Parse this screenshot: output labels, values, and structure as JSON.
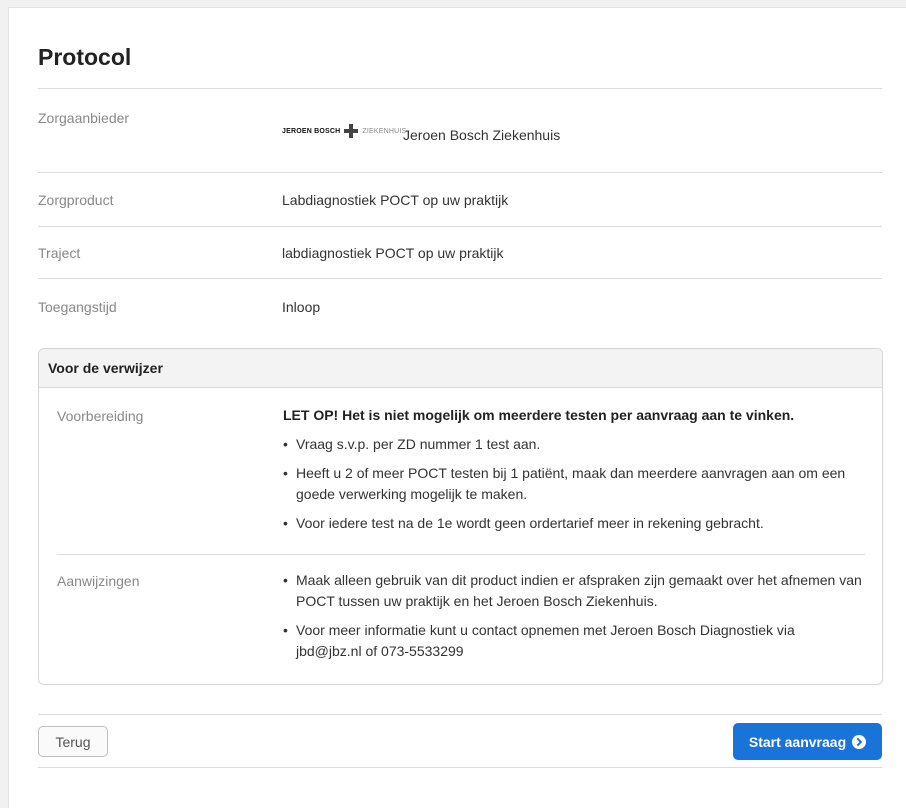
{
  "title": "Protocol",
  "fields": {
    "zorgaanbieder_label": "Zorgaanbieder",
    "logo_text_left": "JEROEN BOSCH",
    "logo_text_right": "ZIEKENHUIS",
    "zorgaanbieder_value": "Jeroen Bosch Ziekenhuis",
    "zorgproduct_label": "Zorgproduct",
    "zorgproduct_value": "Labdiagnostiek POCT op uw praktijk",
    "traject_label": "Traject",
    "traject_value": "labdiagnostiek POCT op uw praktijk",
    "toegangstijd_label": "Toegangstijd",
    "toegangstijd_value": "Inloop"
  },
  "card": {
    "header": "Voor de verwijzer",
    "voorbereiding_label": "Voorbereiding",
    "voorbereiding_heading": "LET OP! Het is niet mogelijk om meerdere testen per aanvraag aan te vinken.",
    "voorbereiding_items": [
      "Vraag s.v.p. per ZD nummer 1 test aan.",
      "Heeft u 2 of meer POCT testen bij 1 patiënt, maak dan meerdere aanvragen aan om een goede verwerking mogelijk te maken.",
      "Voor iedere test na de 1e wordt geen ordertarief meer in rekening gebracht."
    ],
    "aanwijzingen_label": "Aanwijzingen",
    "aanwijzingen_items": [
      "Maak alleen gebruik van dit product indien er afspraken zijn gemaakt over het afnemen van POCT tussen uw praktijk en het Jeroen Bosch Ziekenhuis.",
      "Voor meer informatie kunt u contact opnemen met Jeroen Bosch Diagnostiek via jbd@jbz.nl of 073-5533299"
    ]
  },
  "buttons": {
    "back_label": "Terug",
    "start_label": "Start aanvraag"
  },
  "icons": {
    "start_button_icon": "arrow-circle-right-icon",
    "logo_icon": "cross-icon"
  },
  "colors": {
    "primary": "#1a73d9"
  }
}
